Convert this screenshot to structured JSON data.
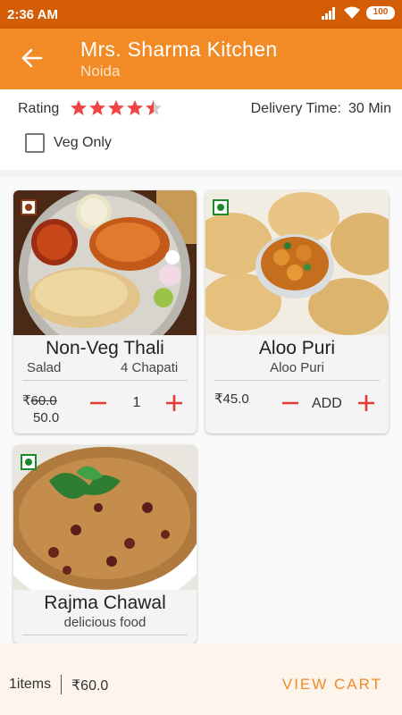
{
  "status": {
    "time": "2:36 AM",
    "battery": "100"
  },
  "header": {
    "title": "Mrs. Sharma Kitchen",
    "subtitle": "Noida"
  },
  "info": {
    "rating_label": "Rating",
    "rating_value": 4.5,
    "delivery_label": "Delivery Time:",
    "delivery_value": "30 Min",
    "veg_only_label": "Veg Only",
    "veg_only_checked": false
  },
  "colors": {
    "accent": "#f28a25",
    "status_bar": "#d35c05",
    "star": "#f04545",
    "veg": "#1a8a2a",
    "non_veg": "#8b3a1a"
  },
  "items": [
    {
      "name": "Non-Veg Thali",
      "desc_left": "Salad",
      "desc_right": "4 Chapati",
      "currency": "₹",
      "old_price": "60.0",
      "new_price": "50.0",
      "quantity": "1",
      "veg": false
    },
    {
      "name": "Aloo Puri",
      "desc": "Aloo Puri",
      "currency": "₹",
      "price": "45.0",
      "add_label": "ADD",
      "veg": true
    },
    {
      "name": "Rajma Chawal",
      "desc": "delicious food",
      "veg": true
    }
  ],
  "cart": {
    "items_label": "1items",
    "total": "₹60.0",
    "view_cart": "VIEW CART"
  }
}
